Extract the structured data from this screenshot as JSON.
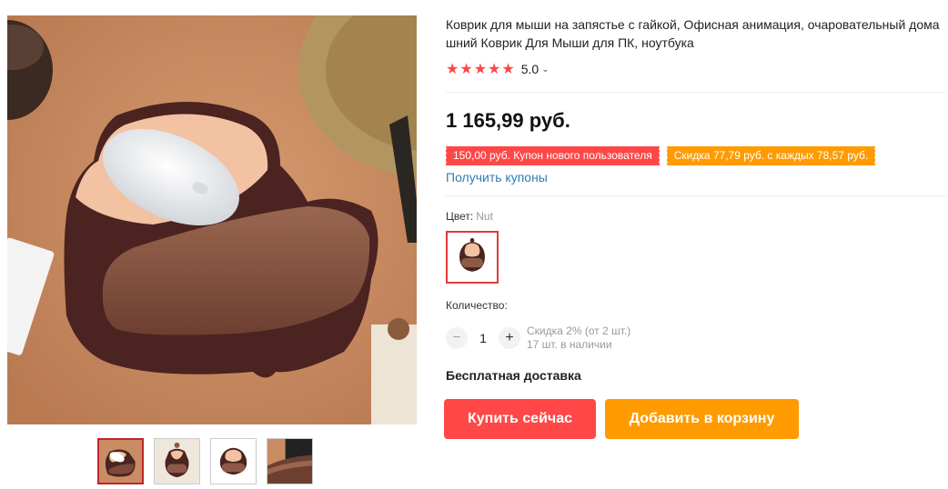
{
  "product": {
    "title": "Коврик для мыши на запястье с гайкой, Офисная анимация, очаровательный домашний Коврик Для Мыши для ПК, ноутбука",
    "rating": {
      "stars": 5,
      "value": "5.0",
      "star_icon": "★",
      "chevron_icon": "⌄"
    },
    "price": "1 165,99 руб.",
    "coupons": {
      "new_user": "150,00 руб. Купон нового пользователя",
      "discount": "Скидка 77,79 руб. с каждых 78,57 руб.",
      "get_link": "Получить купоны"
    },
    "color": {
      "label": "Цвет:",
      "selected": "Nut"
    },
    "quantity": {
      "label": "Количество:",
      "value": "1",
      "minus": "−",
      "plus": "+",
      "discount_note": "Скидка 2% (от 2 шт.)",
      "stock": "17 шт. в наличии"
    },
    "shipping": "Бесплатная доставка",
    "buttons": {
      "buy_now": "Купить сейчас",
      "add_to_cart": "Добавить в корзину"
    }
  },
  "gallery": {
    "thumbnail_count": 4,
    "active_index": 0
  },
  "colors": {
    "accent_red": "#ff4747",
    "accent_orange": "#ff9b00",
    "link_blue": "#2e7db7",
    "star": "#ff4747"
  }
}
